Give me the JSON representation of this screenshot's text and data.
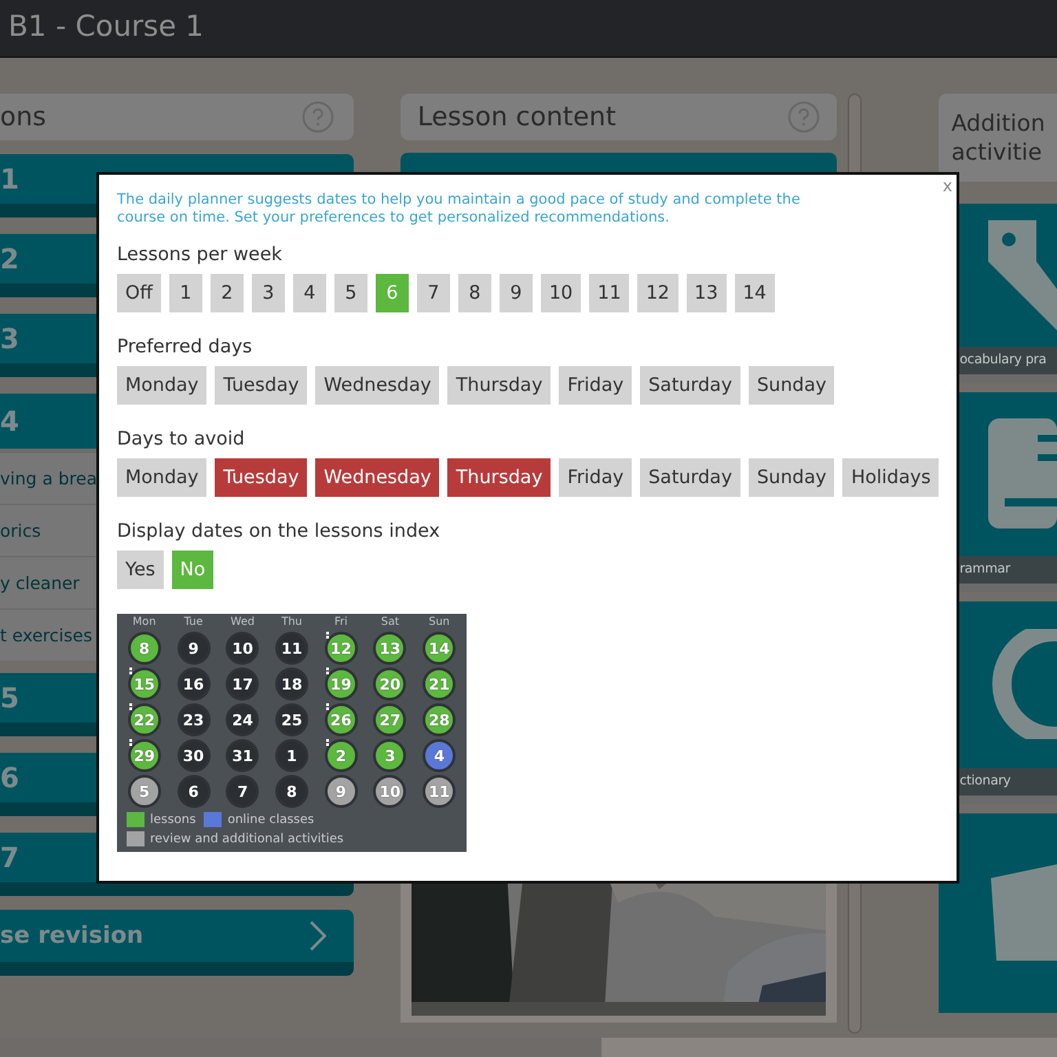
{
  "header": {
    "title": "B1 - Course 1"
  },
  "units_panel": {
    "title": "ons",
    "items": [
      {
        "kind": "unit",
        "label": "1"
      },
      {
        "kind": "unit",
        "label": "2"
      },
      {
        "kind": "unit",
        "label": "3"
      },
      {
        "kind": "unit",
        "label": "4"
      },
      {
        "kind": "lesson",
        "label": "ving a brea"
      },
      {
        "kind": "lesson",
        "label": "orics"
      },
      {
        "kind": "lesson",
        "label": "y cleaner"
      },
      {
        "kind": "lesson",
        "label": "t exercises"
      },
      {
        "kind": "unit",
        "label": "5"
      },
      {
        "kind": "unit",
        "label": "6"
      },
      {
        "kind": "unit",
        "label": "7"
      },
      {
        "kind": "revision",
        "label": "se revision"
      }
    ]
  },
  "content_panel": {
    "title": "Lesson content"
  },
  "activities_panel": {
    "title_lines": [
      "Addition",
      "activitie"
    ],
    "tiles": [
      {
        "caption": "ocabulary pra"
      },
      {
        "caption": "rammar"
      },
      {
        "caption": "ctionary"
      }
    ]
  },
  "planner": {
    "intro": "The daily planner suggests dates to help you maintain a good pace of study and complete the course on time. Set your preferences to get personalized recommendations.",
    "close": "x",
    "groups": [
      {
        "kind": "choice",
        "label": "Lessons per week",
        "options": [
          {
            "label": "Off",
            "selected": false
          },
          {
            "label": "1",
            "selected": false
          },
          {
            "label": "2",
            "selected": false
          },
          {
            "label": "3",
            "selected": false
          },
          {
            "label": "4",
            "selected": false
          },
          {
            "label": "5",
            "selected": false
          },
          {
            "label": "6",
            "selected": true
          },
          {
            "label": "7",
            "selected": false
          },
          {
            "label": "8",
            "selected": false
          },
          {
            "label": "9",
            "selected": false
          },
          {
            "label": "10",
            "selected": false
          },
          {
            "label": "11",
            "selected": false
          },
          {
            "label": "12",
            "selected": false
          },
          {
            "label": "13",
            "selected": false
          },
          {
            "label": "14",
            "selected": false
          }
        ]
      },
      {
        "kind": "choice",
        "label": "Preferred days",
        "options": [
          {
            "label": "Monday",
            "selected": false
          },
          {
            "label": "Tuesday",
            "selected": false
          },
          {
            "label": "Wednesday",
            "selected": false
          },
          {
            "label": "Thursday",
            "selected": false
          },
          {
            "label": "Friday",
            "selected": false
          },
          {
            "label": "Saturday",
            "selected": false
          },
          {
            "label": "Sunday",
            "selected": false
          }
        ]
      },
      {
        "kind": "avoid",
        "label": "Days to avoid",
        "options": [
          {
            "label": "Monday",
            "selected": false
          },
          {
            "label": "Tuesday",
            "selected": true
          },
          {
            "label": "Wednesday",
            "selected": true
          },
          {
            "label": "Thursday",
            "selected": true
          },
          {
            "label": "Friday",
            "selected": false
          },
          {
            "label": "Saturday",
            "selected": false
          },
          {
            "label": "Sunday",
            "selected": false
          },
          {
            "label": "Holidays",
            "selected": false
          }
        ]
      },
      {
        "kind": "choice",
        "label": "Display dates on the lessons index",
        "options": [
          {
            "label": "Yes",
            "selected": false
          },
          {
            "label": "No",
            "selected": true
          }
        ]
      }
    ],
    "calendar": {
      "weekdays": [
        "Mon",
        "Tue",
        "Wed",
        "Thu",
        "Fri",
        "Sat",
        "Sun"
      ],
      "days": [
        {
          "day": "8",
          "kind": "lesson",
          "flag": false
        },
        {
          "day": "9",
          "kind": "free",
          "flag": false
        },
        {
          "day": "10",
          "kind": "free",
          "flag": false
        },
        {
          "day": "11",
          "kind": "free",
          "flag": false
        },
        {
          "day": "12",
          "kind": "lesson",
          "flag": true
        },
        {
          "day": "13",
          "kind": "lesson",
          "flag": false
        },
        {
          "day": "14",
          "kind": "lesson",
          "flag": false
        },
        {
          "day": "15",
          "kind": "lesson",
          "flag": true
        },
        {
          "day": "16",
          "kind": "free",
          "flag": false
        },
        {
          "day": "17",
          "kind": "free",
          "flag": false
        },
        {
          "day": "18",
          "kind": "free",
          "flag": false
        },
        {
          "day": "19",
          "kind": "lesson",
          "flag": true
        },
        {
          "day": "20",
          "kind": "lesson",
          "flag": false
        },
        {
          "day": "21",
          "kind": "lesson",
          "flag": false
        },
        {
          "day": "22",
          "kind": "lesson",
          "flag": true
        },
        {
          "day": "23",
          "kind": "free",
          "flag": false
        },
        {
          "day": "24",
          "kind": "free",
          "flag": false
        },
        {
          "day": "25",
          "kind": "free",
          "flag": false
        },
        {
          "day": "26",
          "kind": "lesson",
          "flag": true
        },
        {
          "day": "27",
          "kind": "lesson",
          "flag": false
        },
        {
          "day": "28",
          "kind": "lesson",
          "flag": false
        },
        {
          "day": "29",
          "kind": "lesson",
          "flag": true
        },
        {
          "day": "30",
          "kind": "free",
          "flag": false
        },
        {
          "day": "31",
          "kind": "free",
          "flag": false
        },
        {
          "day": "1",
          "kind": "free",
          "flag": false
        },
        {
          "day": "2",
          "kind": "lesson",
          "flag": true
        },
        {
          "day": "3",
          "kind": "lesson",
          "flag": false
        },
        {
          "day": "4",
          "kind": "online",
          "flag": false
        },
        {
          "day": "5",
          "kind": "review",
          "flag": false
        },
        {
          "day": "6",
          "kind": "free",
          "flag": false
        },
        {
          "day": "7",
          "kind": "free",
          "flag": false
        },
        {
          "day": "8",
          "kind": "free",
          "flag": false
        },
        {
          "day": "9",
          "kind": "review",
          "flag": false
        },
        {
          "day": "10",
          "kind": "review",
          "flag": false
        },
        {
          "day": "11",
          "kind": "review",
          "flag": false
        }
      ],
      "legend": [
        {
          "label": "lessons",
          "color": "#5cb83e"
        },
        {
          "label": "online classes",
          "color": "#5a78d8"
        },
        {
          "label": "review and additional activities",
          "color": "#a3a3a3"
        }
      ]
    }
  }
}
